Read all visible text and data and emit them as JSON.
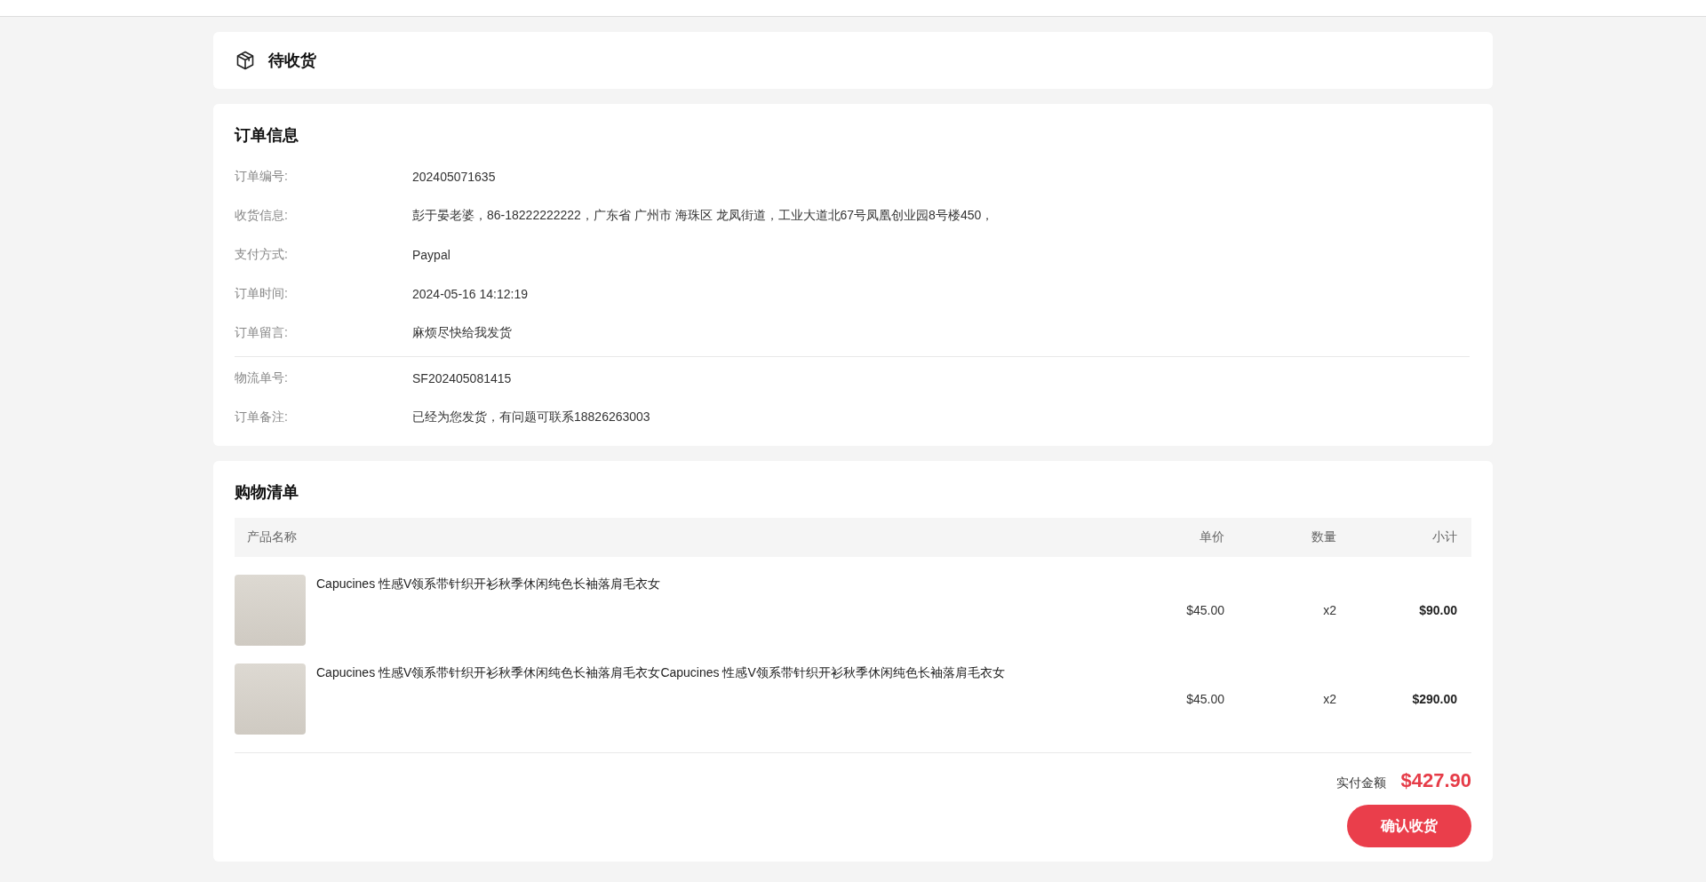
{
  "status": {
    "label": "待收货"
  },
  "order_info": {
    "title": "订单信息",
    "rows": [
      {
        "label": "订单编号:",
        "value": "202405071635"
      },
      {
        "label": "收货信息:",
        "value": "彭于晏老婆，86-18222222222，广东省 广州市 海珠区 龙凤街道，工业大道北67号凤凰创业园8号楼450，"
      },
      {
        "label": "支付方式:",
        "value": "Paypal"
      },
      {
        "label": "订单时间:",
        "value": "2024-05-16 14:12:19"
      },
      {
        "label": "订单留言:",
        "value": "麻烦尽快给我发货"
      }
    ],
    "logistics_rows": [
      {
        "label": "物流单号:",
        "value": "SF202405081415"
      },
      {
        "label": "订单备注:",
        "value": "已经为您发货，有问题可联系18826263003"
      }
    ]
  },
  "shopping_list": {
    "title": "购物清单",
    "columns": [
      "产品名称",
      "单价",
      "数量",
      "小计"
    ],
    "rows": [
      {
        "name": "Capucines 性感V领系带针织开衫秋季休闲纯色长袖落肩毛衣女",
        "price": "$45.00",
        "quantity": "x2",
        "subtotal": "$90.00"
      },
      {
        "name": "Capucines 性感V领系带针织开衫秋季休闲纯色长袖落肩毛衣女Capucines 性感V领系带针织开衫秋季休闲纯色长袖落肩毛衣女",
        "price": "$45.00",
        "quantity": "x2",
        "subtotal": "$290.00"
      }
    ],
    "total_label": "实付金额",
    "total": "$427.90",
    "button": "确认收货"
  }
}
